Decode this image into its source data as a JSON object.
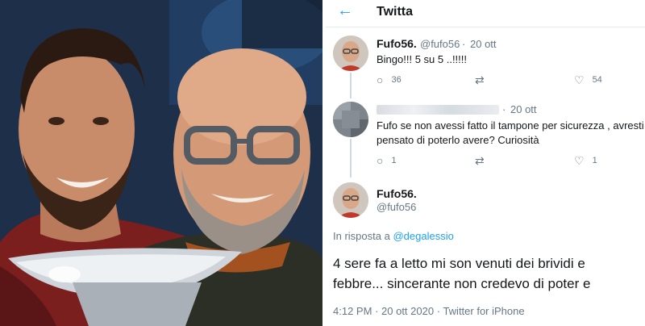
{
  "header": {
    "title": "Twitta"
  },
  "tweet1": {
    "name": "Fufo56.",
    "handle": "@fufo56",
    "separator": "·",
    "date": "20 ott",
    "text": "Bingo!!! 5 su 5 ..!!!!!",
    "replies": "36",
    "likes": "54"
  },
  "tweet2": {
    "separator": "·",
    "date": "20 ott",
    "text_line1": "Fufo se non avessi fatto il tampone per sicurezza , avresti",
    "text_line2": "pensato di poterlo avere? Curiosità",
    "replies": "1",
    "likes": "1"
  },
  "tweet3": {
    "name": "Fufo56.",
    "handle": "@fufo56",
    "reply_prefix": "In risposta a",
    "reply_mention": "@degalessio",
    "text_line1": "4 sere fa a letto mi son venuti dei brividi e",
    "text_line2": "febbre... sincerante non credevo di poter e",
    "time": "4:12 PM",
    "date": "20 ott 2020",
    "client": "Twitter for iPhone"
  },
  "icons": {
    "back": "arrow-left-icon",
    "reply": "reply-icon",
    "retweet": "retweet-icon",
    "like": "heart-icon"
  },
  "colors": {
    "accent": "#1da1f2",
    "secondary_text": "#657786",
    "border": "#e6ecf0"
  }
}
